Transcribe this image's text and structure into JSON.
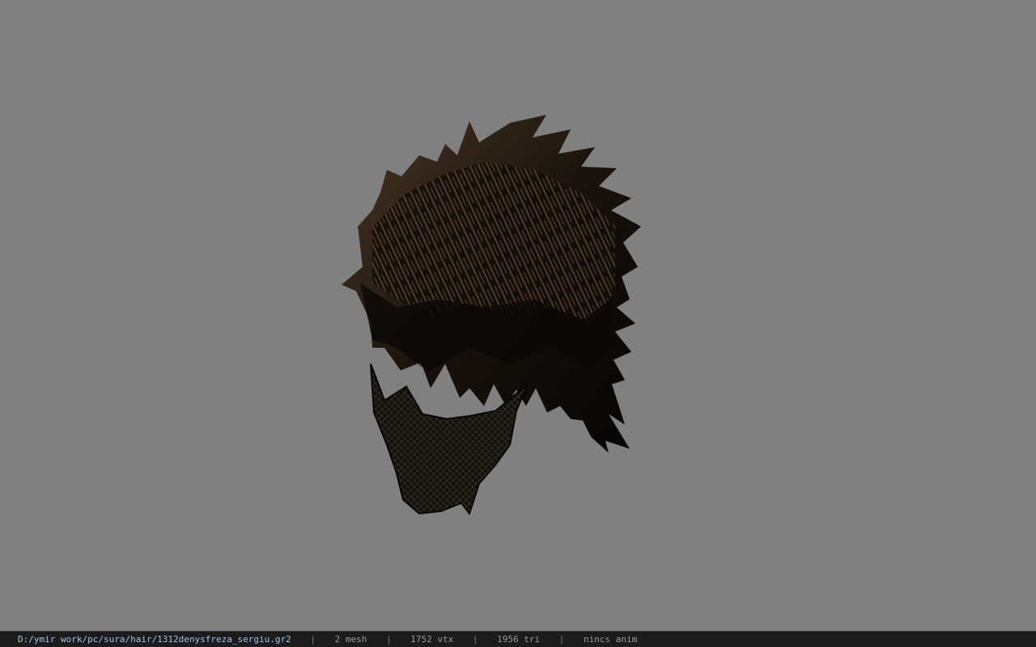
{
  "viewport": {
    "background_color": "#808080",
    "model": {
      "description_icon": "hair-mesh-model",
      "hair_dark_color": "#0d0a08",
      "hair_light_color": "#6b5238",
      "mask_color": "#1a1612"
    }
  },
  "status_bar": {
    "file_path": "D:/ymir work/pc/sura/hair/1312denysfreza_sergiu.gr2",
    "separator": "|",
    "mesh_count": "2 mesh",
    "vertex_count": "1752 vtx",
    "triangle_count": "1956 tri",
    "anim_status": "nincs anim"
  }
}
